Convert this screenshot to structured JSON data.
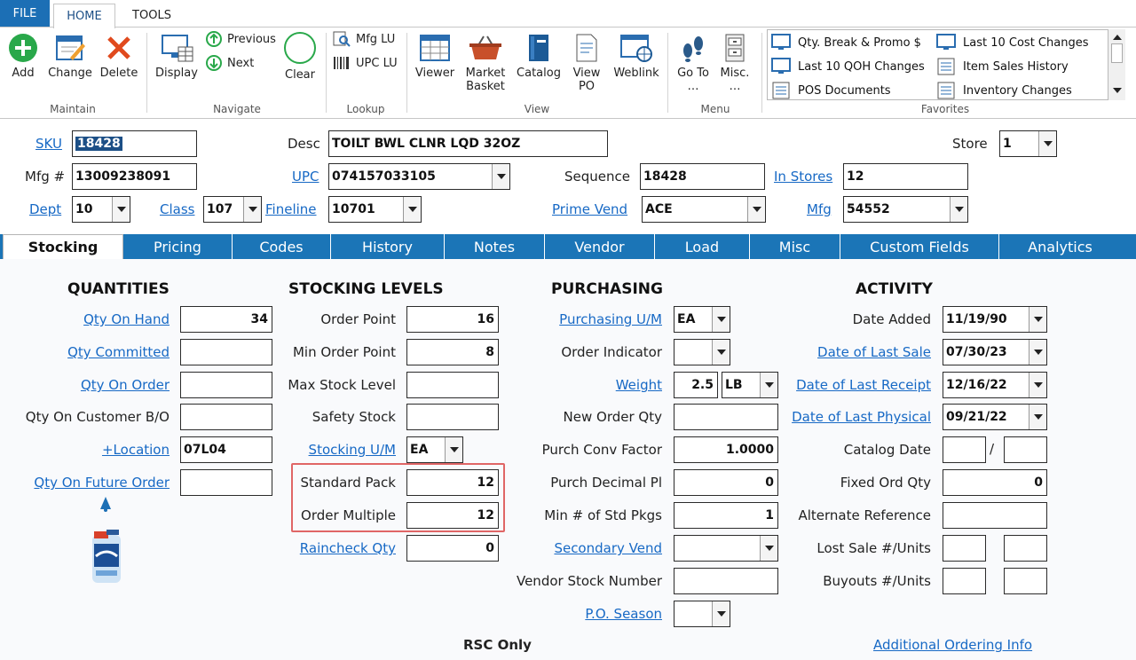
{
  "menu": {
    "file": "FILE",
    "home": "HOME",
    "tools": "TOOLS"
  },
  "ribbon": {
    "add": "Add",
    "change": "Change",
    "delete": "Delete",
    "maintain": "Maintain",
    "display": "Display",
    "previous": "Previous",
    "next": "Next",
    "clear": "Clear",
    "navigate": "Navigate",
    "mfg_lu": "Mfg LU",
    "upc_lu": "UPC LU",
    "lookup": "Lookup",
    "viewer": "Viewer",
    "market_basket_1": "Market",
    "market_basket_2": "Basket",
    "catalog": "Catalog",
    "view_po_1": "View",
    "view_po_2": "PO",
    "weblink": "Weblink",
    "view": "View",
    "goto_1": "Go To",
    "goto_2": "…",
    "misc_1": "Misc.",
    "misc_2": "…",
    "menu": "Menu",
    "favorites": "Favorites",
    "fav": [
      "Qty. Break & Promo $",
      "Last 10 Cost Changes",
      "Last 10 QOH Changes",
      "Item Sales History",
      "POS Documents",
      "Inventory Changes"
    ]
  },
  "header": {
    "sku_label": "SKU",
    "sku": "18428",
    "desc_label": "Desc",
    "desc": "TOILT BWL CLNR LQD 32OZ",
    "store_label": "Store",
    "store": "1",
    "mfg_label": "Mfg #",
    "mfg": "13009238091",
    "upc_label": "UPC",
    "upc": "074157033105",
    "seq_label": "Sequence",
    "seq": "18428",
    "instores_label": "In Stores",
    "instores": "12",
    "dept_label": "Dept",
    "dept": "10",
    "class_label": "Class",
    "class": "107",
    "fineline_label": "Fineline",
    "fineline": "10701",
    "primevend_label": "Prime Vend",
    "primevend": "ACE",
    "mfgc_label": "Mfg",
    "mfgc": "54552"
  },
  "tabs": [
    "Stocking",
    "Pricing",
    "Codes",
    "History",
    "Notes",
    "Vendor",
    "Load",
    "Misc",
    "Custom Fields",
    "Analytics"
  ],
  "quantities": {
    "title": "QUANTITIES",
    "qoh_l": "Qty On Hand",
    "qoh": "34",
    "qc_l": "Qty Committed",
    "qc": "",
    "qoo_l": "Qty On Order",
    "qoo": "",
    "qcbo_l": "Qty On Customer B/O",
    "qcbo": "",
    "loc_l": "+Location",
    "loc": "07L04",
    "qfo_l": "Qty On Future Order",
    "qfo": ""
  },
  "stocking": {
    "title": "STOCKING LEVELS",
    "op_l": "Order Point",
    "op": "16",
    "mop_l": "Min Order Point",
    "mop": "8",
    "msl_l": "Max Stock Level",
    "msl": "",
    "ss_l": "Safety Stock",
    "ss": "",
    "su_l": "Stocking U/M",
    "su": "EA",
    "sp_l": "Standard Pack",
    "sp": "12",
    "om_l": "Order Multiple",
    "om": "12",
    "rc_l": "Raincheck Qty",
    "rc": "0"
  },
  "purchasing": {
    "title": "PURCHASING",
    "pu_l": "Purchasing U/M",
    "pu": "EA",
    "oi_l": "Order Indicator",
    "oi": "",
    "wt_l": "Weight",
    "wt": "2.5",
    "wtu": "LB",
    "noq_l": "New Order Qty",
    "noq": "",
    "pcf_l": "Purch Conv Factor",
    "pcf": "1.0000",
    "pdp_l": "Purch Decimal Pl",
    "pdp": "0",
    "msp_l": "Min # of Std Pkgs",
    "msp": "1",
    "sv_l": "Secondary Vend",
    "sv": "",
    "vsn_l": "Vendor Stock Number",
    "vsn": "",
    "pos_l": "P.O. Season",
    "pos": "",
    "rsc": "RSC Only"
  },
  "activity": {
    "title": "ACTIVITY",
    "da_l": "Date Added",
    "da": "11/19/90",
    "dls_l": "Date of Last Sale",
    "dls": "07/30/23",
    "dlr_l": "Date of Last Receipt",
    "dlr": "12/16/22",
    "dlp_l": "Date of Last Physical",
    "dlp": "09/21/22",
    "cd_l": "Catalog Date",
    "cd_sep": "/",
    "foq_l": "Fixed Ord Qty",
    "foq": "0",
    "ar_l": "Alternate Reference",
    "ls_l": "Lost Sale #/Units",
    "bo_l": "Buyouts #/Units",
    "aoi": "Additional Ordering Info"
  }
}
